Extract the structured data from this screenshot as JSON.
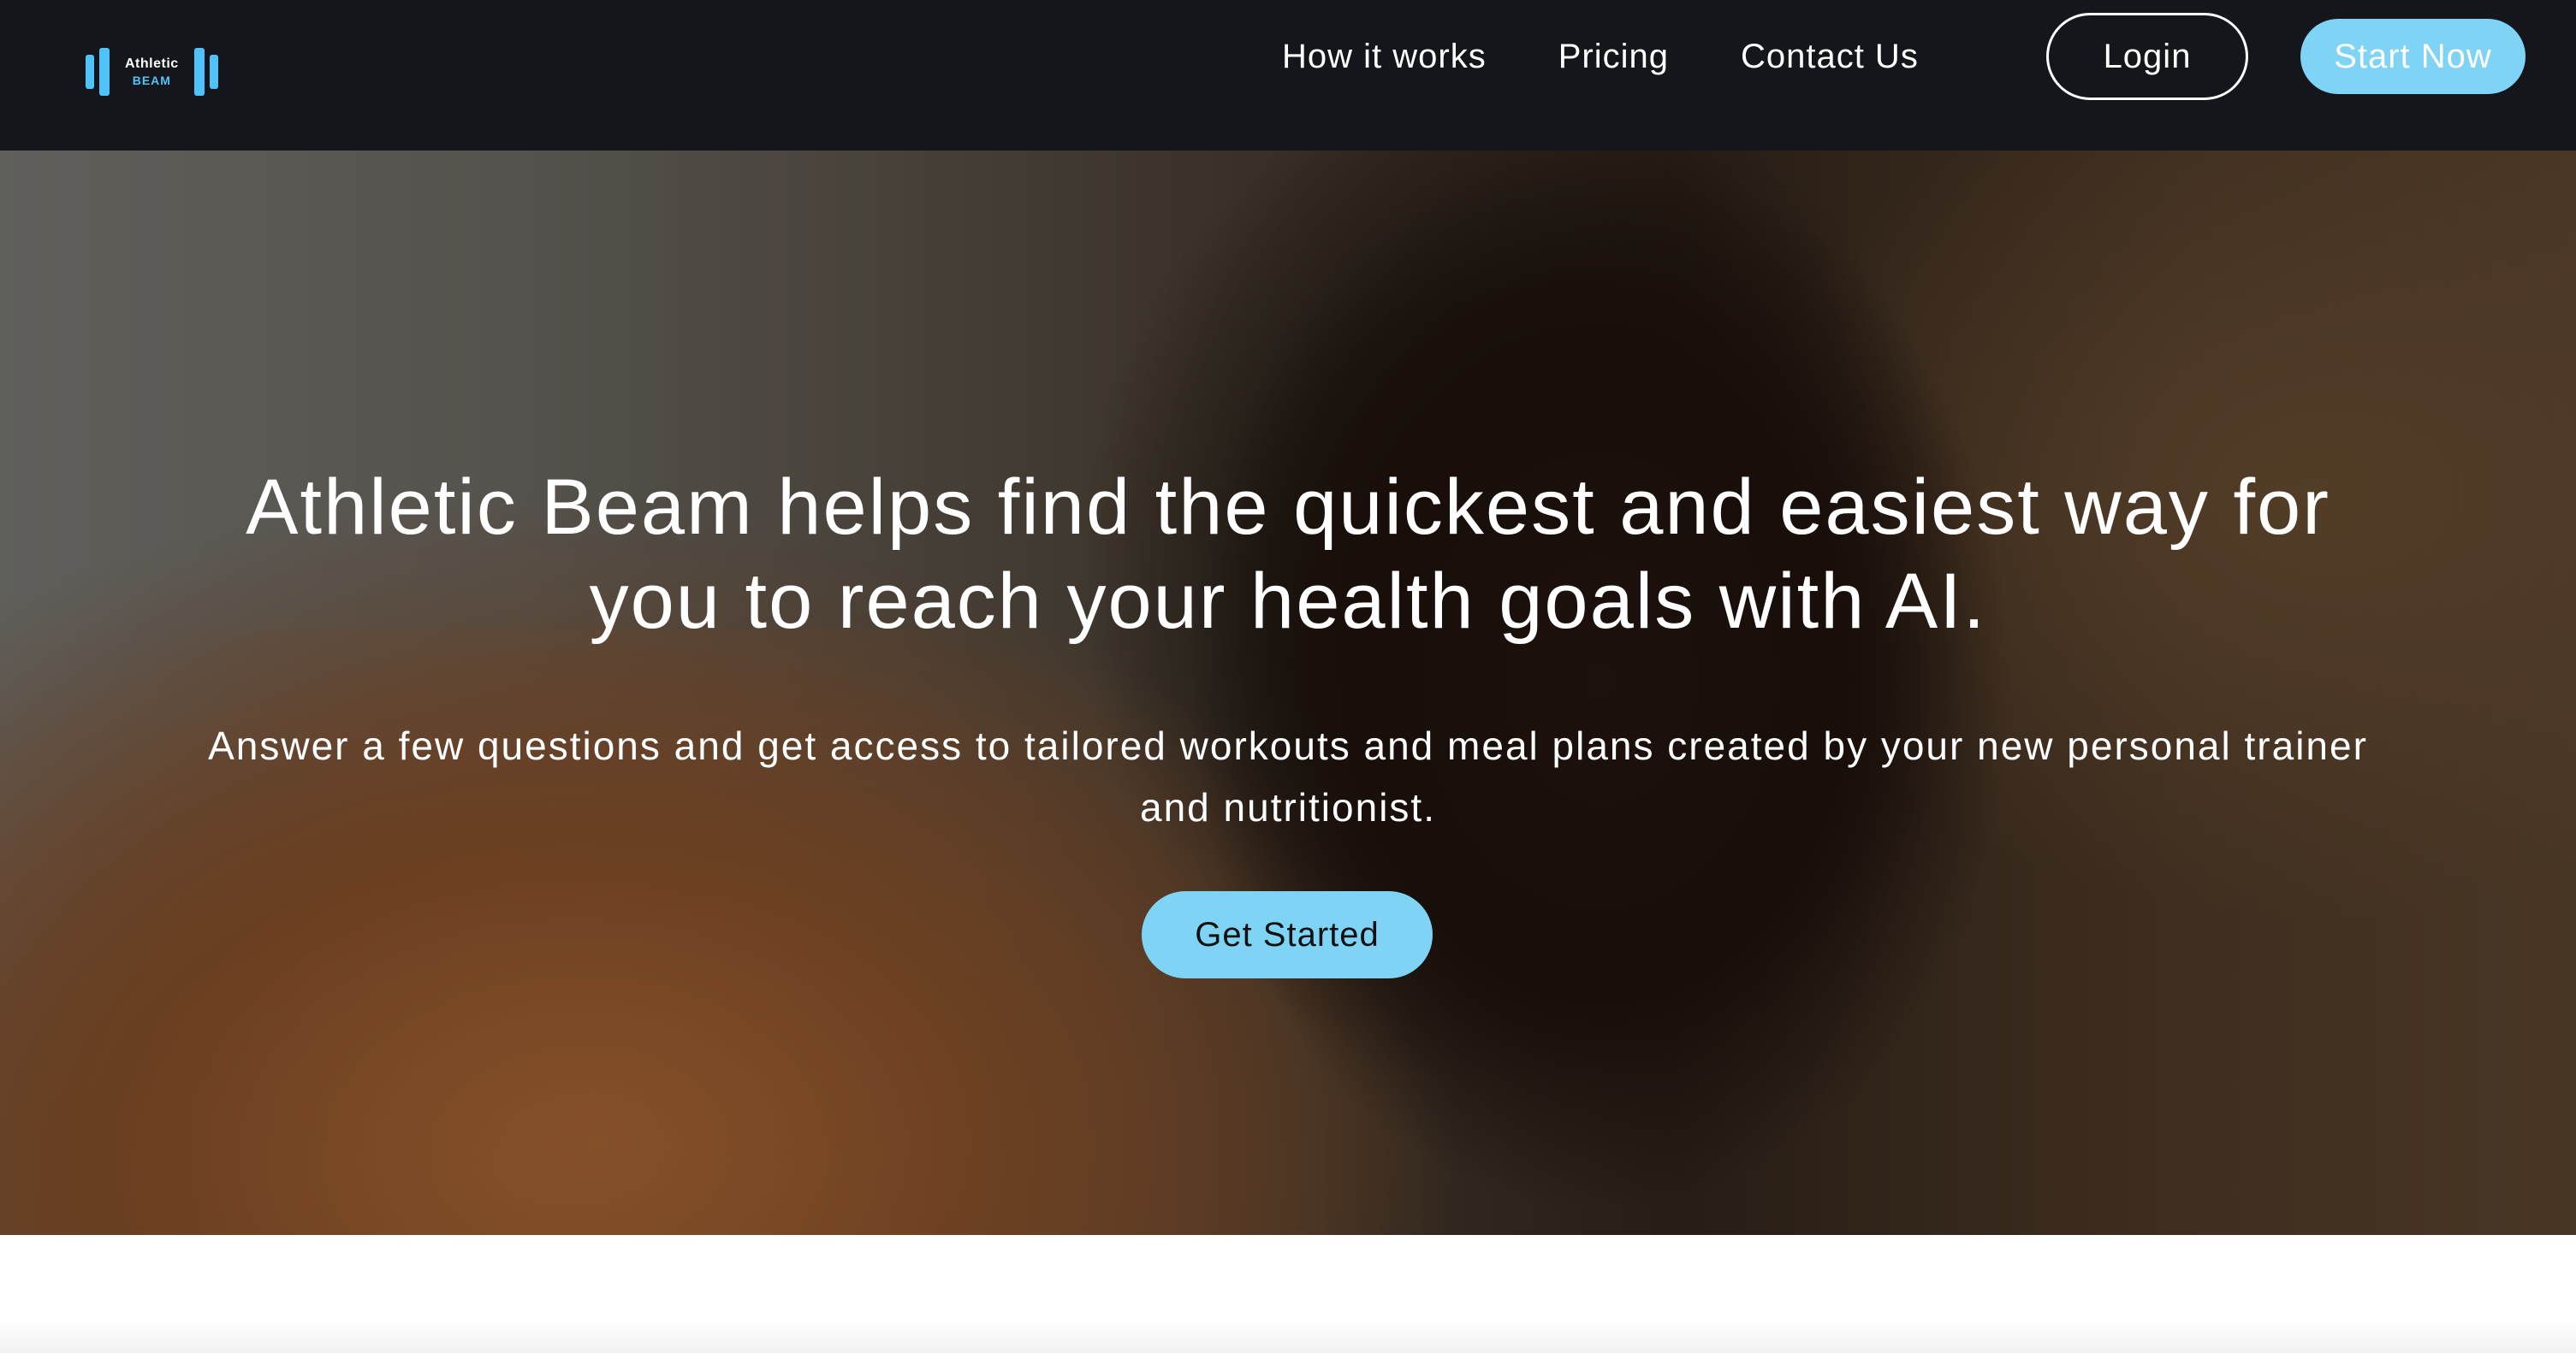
{
  "brand": {
    "logo_line1": "Athletic",
    "logo_line2": "BEAM",
    "logo_icon": "dumbbell-bars-icon",
    "accent_color": "#4fc3f7"
  },
  "nav": {
    "items": [
      {
        "label": "How it works"
      },
      {
        "label": "Pricing"
      },
      {
        "label": "Contact Us"
      }
    ],
    "login_label": "Login",
    "start_label": "Start Now"
  },
  "hero": {
    "title": "Athletic Beam helps find the quickest and easiest way for you to reach your health goals with AI.",
    "subtitle": "Answer a few questions and get access to tailored workouts and meal plans created by your new personal trainer and nutritionist.",
    "cta_label": "Get Started",
    "background_image": "person-in-orange-shirt-photo"
  },
  "colors": {
    "header_bg": "#14161b",
    "button_blue": "#7fd4f6",
    "text_white": "#ffffff"
  }
}
